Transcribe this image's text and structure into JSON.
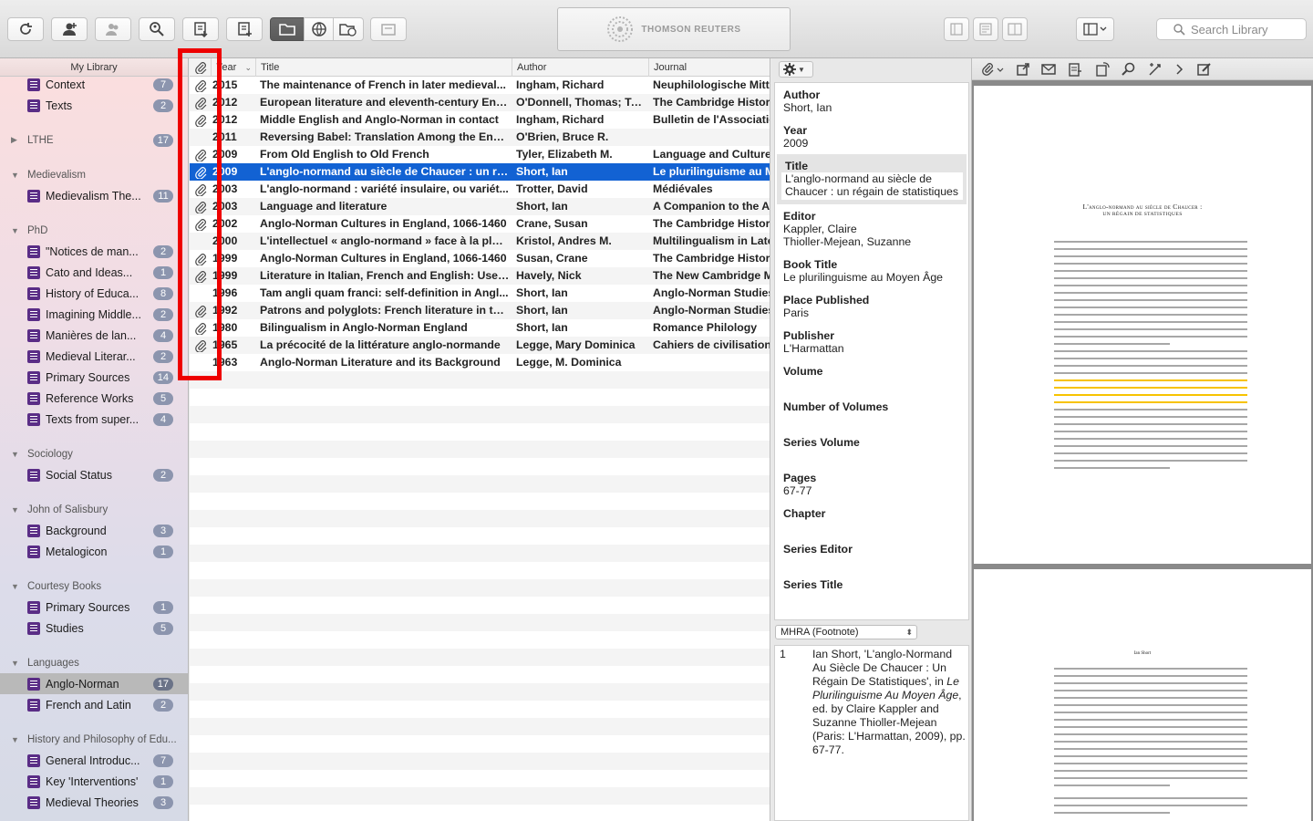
{
  "toolbar": {
    "logo_text": "THOMSON REUTERS",
    "search_placeholder": "Search Library"
  },
  "sidebar": {
    "header": "My Library",
    "entries": [
      {
        "kind": "item",
        "label": "Context",
        "count": "7"
      },
      {
        "kind": "item",
        "label": "Texts",
        "count": "2"
      },
      {
        "kind": "group",
        "label": "LTHE",
        "collapsed": true,
        "count": "17"
      },
      {
        "kind": "group",
        "label": "Medievalism"
      },
      {
        "kind": "item",
        "label": "Medievalism The...",
        "count": "11"
      },
      {
        "kind": "group",
        "label": "PhD"
      },
      {
        "kind": "item",
        "label": "\"Notices de man...",
        "count": "2"
      },
      {
        "kind": "item",
        "label": "Cato and Ideas...",
        "count": "1"
      },
      {
        "kind": "item",
        "label": "History of Educa...",
        "count": "8"
      },
      {
        "kind": "item",
        "label": "Imagining Middle...",
        "count": "2"
      },
      {
        "kind": "item",
        "label": "Manières de lan...",
        "count": "4"
      },
      {
        "kind": "item",
        "label": "Medieval Literar...",
        "count": "2"
      },
      {
        "kind": "item",
        "label": "Primary Sources",
        "count": "14"
      },
      {
        "kind": "item",
        "label": "Reference Works",
        "count": "5"
      },
      {
        "kind": "item",
        "label": "Texts from super...",
        "count": "4"
      },
      {
        "kind": "group",
        "label": "Sociology"
      },
      {
        "kind": "item",
        "label": "Social Status",
        "count": "2"
      },
      {
        "kind": "group",
        "label": "John of Salisbury"
      },
      {
        "kind": "item",
        "label": "Background",
        "count": "3"
      },
      {
        "kind": "item",
        "label": "Metalogicon",
        "count": "1"
      },
      {
        "kind": "group",
        "label": "Courtesy Books"
      },
      {
        "kind": "item",
        "label": "Primary Sources",
        "count": "1"
      },
      {
        "kind": "item",
        "label": "Studies",
        "count": "5"
      },
      {
        "kind": "group",
        "label": "Languages"
      },
      {
        "kind": "item",
        "label": "Anglo-Norman",
        "count": "17",
        "selected": true
      },
      {
        "kind": "item",
        "label": "French and Latin",
        "count": "2"
      },
      {
        "kind": "group",
        "label": "History and Philosophy of Edu..."
      },
      {
        "kind": "item",
        "label": "General Introduc...",
        "count": "7"
      },
      {
        "kind": "item",
        "label": "Key 'Interventions'",
        "count": "1"
      },
      {
        "kind": "item",
        "label": "Medieval Theories",
        "count": "3"
      }
    ]
  },
  "list": {
    "columns": {
      "year": "Year",
      "title": "Title",
      "author": "Author",
      "journal": "Journal"
    },
    "rows": [
      {
        "clip": true,
        "year": "2015",
        "title": "The maintenance of French in later medieval...",
        "author": "Ingham, Richard",
        "journal": "Neuphilologische Mitte"
      },
      {
        "clip": true,
        "year": "2012",
        "title": "European literature and eleventh-century Eng...",
        "author": "O'Donnell, Thomas; To...",
        "journal": "The Cambridge History"
      },
      {
        "clip": true,
        "year": "2012",
        "title": "Middle English and Anglo-Norman in contact",
        "author": "Ingham, Richard",
        "journal": "Bulletin de l'Associatio"
      },
      {
        "clip": false,
        "year": "2011",
        "title": "Reversing Babel: Translation Among the Engl...",
        "author": "O'Brien, Bruce R.",
        "journal": ""
      },
      {
        "clip": true,
        "year": "2009",
        "title": "From Old English to Old French",
        "author": "Tyler, Elizabeth M.",
        "journal": "Language and Culture"
      },
      {
        "clip": true,
        "year": "2009",
        "title": "L'anglo-normand au siècle de Chaucer : un ré...",
        "author": "Short, Ian",
        "journal": "Le plurilinguisme au M",
        "selected": true
      },
      {
        "clip": true,
        "year": "2003",
        "title": "L'anglo-normand : variété insulaire, ou variét...",
        "author": "Trotter, David",
        "journal": "Médiévales"
      },
      {
        "clip": true,
        "year": "2003",
        "title": "Language and literature",
        "author": "Short, Ian",
        "journal": "A Companion to the Ar"
      },
      {
        "clip": true,
        "year": "2002",
        "title": "Anglo-Norman Cultures in England, 1066-1460",
        "author": "Crane, Susan",
        "journal": "The Cambridge History"
      },
      {
        "clip": false,
        "year": "2000",
        "title": "L'intellectuel « anglo-normand » face à la plur...",
        "author": "Kristol, Andres M.",
        "journal": "Multilingualism in Late"
      },
      {
        "clip": true,
        "year": "1999",
        "title": "Anglo-Norman Cultures in England, 1066-1460",
        "author": "Susan, Crane",
        "journal": "The Cambridge History"
      },
      {
        "clip": true,
        "year": "1999",
        "title": "Literature in Italian, French and English: Uses...",
        "author": "Havely, Nick",
        "journal": "The New Cambridge M"
      },
      {
        "clip": false,
        "year": "1996",
        "title": "Tam angli quam franci: self-definition in Angl...",
        "author": "Short, Ian",
        "journal": "Anglo-Norman Studies"
      },
      {
        "clip": true,
        "year": "1992",
        "title": "Patrons and polyglots: French literature in tw...",
        "author": "Short, Ian",
        "journal": "Anglo-Norman Studies"
      },
      {
        "clip": true,
        "year": "1980",
        "title": "Bilingualism in Anglo-Norman England",
        "author": "Short, Ian",
        "journal": "Romance Philology"
      },
      {
        "clip": true,
        "year": "1965",
        "title": "La précocité de la littérature anglo-normande",
        "author": "Legge, Mary Dominica",
        "journal": "Cahiers de civilisation"
      },
      {
        "clip": false,
        "year": "1963",
        "title": "Anglo-Norman Literature and its Background",
        "author": "Legge, M. Dominica",
        "journal": ""
      }
    ]
  },
  "detail": {
    "fields": [
      {
        "name": "Author",
        "value": "Short, Ian"
      },
      {
        "name": "Year",
        "value": "2009"
      },
      {
        "name": "Title",
        "value": "L'anglo-normand au siècle de Chaucer : un régain de statistiques",
        "highlight": true
      },
      {
        "name": "Editor",
        "value": "Kappler, Claire\nThioller-Mejean, Suzanne"
      },
      {
        "name": "Book Title",
        "value": "Le plurilinguisme au Moyen Âge"
      },
      {
        "name": "Place Published",
        "value": "Paris"
      },
      {
        "name": "Publisher",
        "value": "L'Harmattan"
      },
      {
        "name": "Volume",
        "value": ""
      },
      {
        "name": "Number of Volumes",
        "value": ""
      },
      {
        "name": "Series Volume",
        "value": ""
      },
      {
        "name": "Pages",
        "value": "67-77"
      },
      {
        "name": "Chapter",
        "value": ""
      },
      {
        "name": "Series Editor",
        "value": ""
      },
      {
        "name": "Series Title",
        "value": ""
      }
    ],
    "style": "MHRA (Footnote)",
    "preview": {
      "number": "1",
      "before": "Ian Short, 'L'anglo-Normand Au Siècle De Chaucer : Un Régain De Statistiques', in ",
      "italic": "Le Plurilinguisme Au Moyen Âge",
      "after": ", ed. by Claire Kappler and Suzanne Thioller-Mejean (Paris: L'Harmattan, 2009), pp. 67-77."
    }
  },
  "pdf": {
    "page1_title": "L'anglo-normand au siècle de Chaucer :",
    "page1_subtitle": "un régain de statistiques",
    "page2_header": "Ian Short",
    "highlight_color": "#f7c300"
  }
}
